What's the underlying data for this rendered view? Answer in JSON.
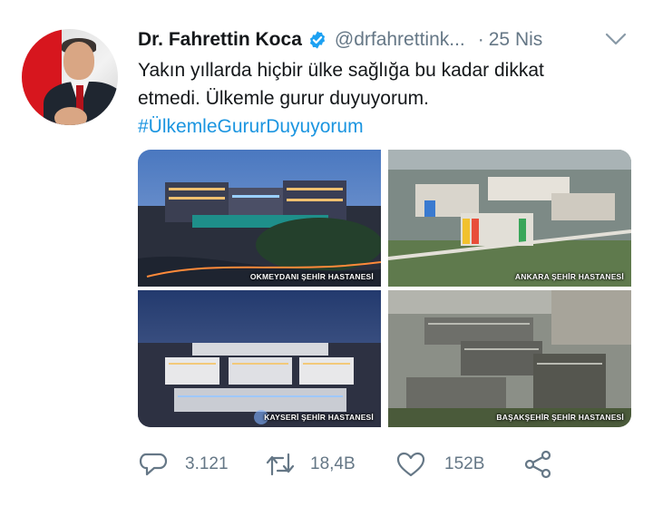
{
  "tweet": {
    "author": {
      "display_name": "Dr. Fahrettin Koca",
      "verified": true,
      "handle": "@drfahrettink...",
      "date": "25 Nis"
    },
    "text_line1": "Yakın yıllarda hiçbir ülke sağlığa bu kadar dikkat",
    "text_line2": "etmedi. Ülkemle gurur duyuyorum.",
    "hashtag": "#ÜlkemleGururDuyuyorum",
    "media": [
      {
        "caption": "OKMEYDANI ŞEHİR HASTANESİ"
      },
      {
        "caption": "ANKARA ŞEHİR HASTANESİ"
      },
      {
        "caption": "KAYSERİ ŞEHİR HASTANESİ"
      },
      {
        "caption": "BAŞAKŞEHİR ŞEHİR HASTANESİ"
      }
    ],
    "actions": {
      "reply_count": "3.121",
      "retweet_count": "18,4B",
      "like_count": "152B"
    }
  },
  "colors": {
    "text": "#14171a",
    "secondary": "#657786",
    "link": "#1b95e0",
    "verified": "#1da1f2"
  },
  "icons": [
    "verified-badge-icon",
    "chevron-down-icon",
    "reply-icon",
    "retweet-icon",
    "like-icon",
    "share-icon"
  ]
}
